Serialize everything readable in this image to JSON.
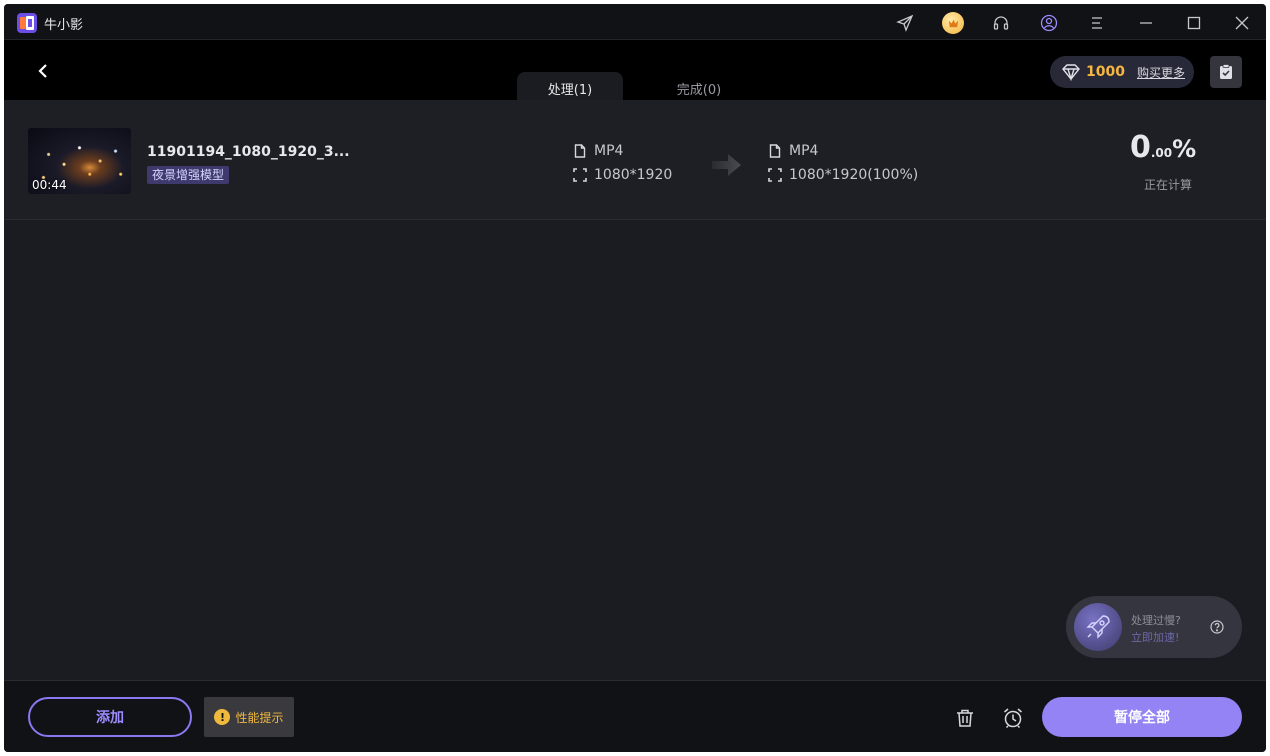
{
  "app": {
    "title": "牛小影"
  },
  "titlebar_icons": [
    "send-icon",
    "vip-icon",
    "headset-icon",
    "user-icon",
    "menu-icon",
    "minimize-icon",
    "maximize-icon",
    "close-icon"
  ],
  "header": {
    "tabs": [
      {
        "label": "处理(1)",
        "active": true
      },
      {
        "label": "完成(0)",
        "active": false
      }
    ],
    "credits": {
      "amount": "1000",
      "buy_label": "购买更多"
    }
  },
  "tasks": [
    {
      "duration": "00:44",
      "filename": "11901194_1080_1920_3...",
      "model": "夜景增强模型",
      "source": {
        "format": "MP4",
        "resolution": "1080*1920"
      },
      "target": {
        "format": "MP4",
        "resolution": "1080*1920(100%)"
      },
      "progress": {
        "integer": "0",
        "decimal": ".00",
        "symbol": "%",
        "status": "正在计算"
      }
    }
  ],
  "speedup": {
    "line1": "处理过慢?",
    "line2": "立即加速!"
  },
  "footer": {
    "add_label": "添加",
    "perf_label": "性能提示",
    "pause_all_label": "暂停全部"
  },
  "colors": {
    "accent": "#9383f5",
    "gold": "#f5b740",
    "background": "#1b1c21"
  }
}
